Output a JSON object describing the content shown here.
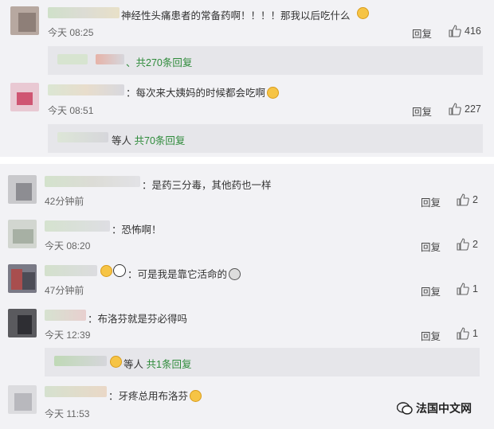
{
  "comments_top": [
    {
      "text": "神经性头痛患者的常备药啊！！！！那我以后吃什么",
      "time": "今天 08:25",
      "reply": "回复",
      "likes": "416"
    },
    {
      "text": "：每次来大姨妈的时候都会吃啊",
      "time": "今天 08:51",
      "reply": "回复",
      "likes": "227"
    }
  ],
  "more_replies_1": {
    "text": "、共270条回复"
  },
  "more_replies_2": {
    "prefix": "等人",
    "text": "共70条回复"
  },
  "comments_bottom": [
    {
      "text": "：是药三分毒，其他药也一样",
      "time": "42分钟前",
      "reply": "回复",
      "likes": "2"
    },
    {
      "text": "：恐怖啊！",
      "time": "今天 08:20",
      "reply": "回复",
      "likes": "2"
    },
    {
      "text": "：可是我是靠它活命的",
      "time": "47分钟前",
      "reply": "回复",
      "likes": "1"
    },
    {
      "text": "：布洛芬就是芬必得吗",
      "time": "今天 12:39",
      "reply": "回复",
      "likes": "1"
    },
    {
      "text": "：牙疼总用布洛芬",
      "time": "今天 11:53"
    }
  ],
  "more_replies_3": {
    "prefix": "等人",
    "text": "共1条回复"
  },
  "watermark": {
    "text": "法国中文网"
  }
}
